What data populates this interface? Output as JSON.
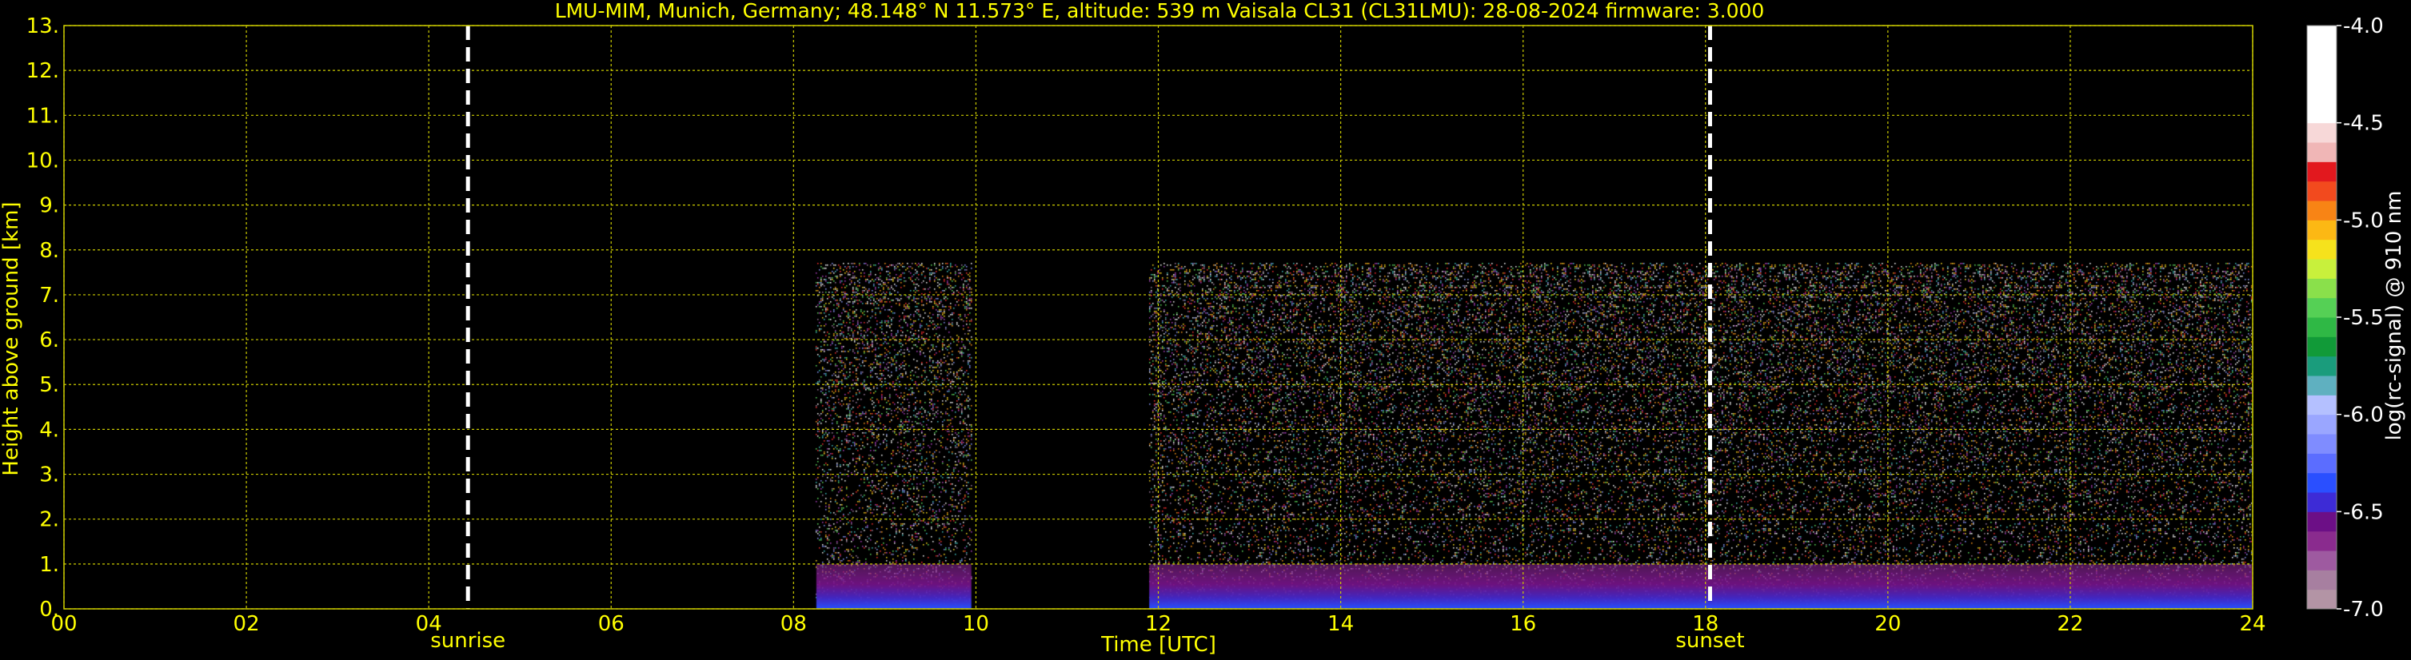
{
  "chart_data": {
    "type": "heatmap",
    "title": "LMU-MIM, Munich, Germany; 48.148° N 11.573° E, altitude: 539 m    Vaisala CL31 (CL31LMU): 28-08-2024    firmware: 3.000",
    "xlabel": "Time [UTC]",
    "ylabel": "Height above ground [km]",
    "xlim": [
      0,
      24
    ],
    "ylim": [
      0,
      13
    ],
    "x_ticks": [
      "00",
      "02",
      "04",
      "06",
      "08",
      "10",
      "12",
      "14",
      "16",
      "18",
      "20",
      "22",
      "24"
    ],
    "y_ticks": [
      "0.",
      "1.",
      "2.",
      "3.",
      "4.",
      "5.",
      "6.",
      "7.",
      "8.",
      "9.",
      "10.",
      "11.",
      "12.",
      "13."
    ],
    "grid": true,
    "data_segments": [
      {
        "start": 8.25,
        "end": 9.95,
        "top_km": 7.7
      },
      {
        "start": 11.9,
        "end": 24.0,
        "top_km": 7.7
      }
    ],
    "boundary_layer_top_km": 1.0,
    "event_lines": [
      {
        "time": 4.43,
        "label": "sunrise"
      },
      {
        "time": 18.05,
        "label": "sunset"
      }
    ],
    "colorbar": {
      "label": "log(rc-signal) @ 910 nm",
      "min": -7.0,
      "max": -4.0,
      "ticks": [
        "-4.0",
        "-4.5",
        "-5.0",
        "-5.5",
        "-6.0",
        "-6.5",
        "-7.0"
      ],
      "colors": [
        "#b394a5",
        "#a77fa0",
        "#9e5aa0",
        "#8a2b8e",
        "#6c0f86",
        "#3d2bd6",
        "#2a4fff",
        "#5b6dff",
        "#7f8cff",
        "#9aa6ff",
        "#b4c0ff",
        "#5fb0c0",
        "#1a9c7c",
        "#119a38",
        "#2fb845",
        "#55d055",
        "#8ae04b",
        "#c8f03c",
        "#f6e21c",
        "#fcb814",
        "#f88415",
        "#f24a1e",
        "#e2181e",
        "#f0b6b6",
        "#f7d8d8",
        "#ffffff",
        "#ffffff",
        "#ffffff",
        "#ffffff",
        "#ffffff"
      ]
    }
  }
}
